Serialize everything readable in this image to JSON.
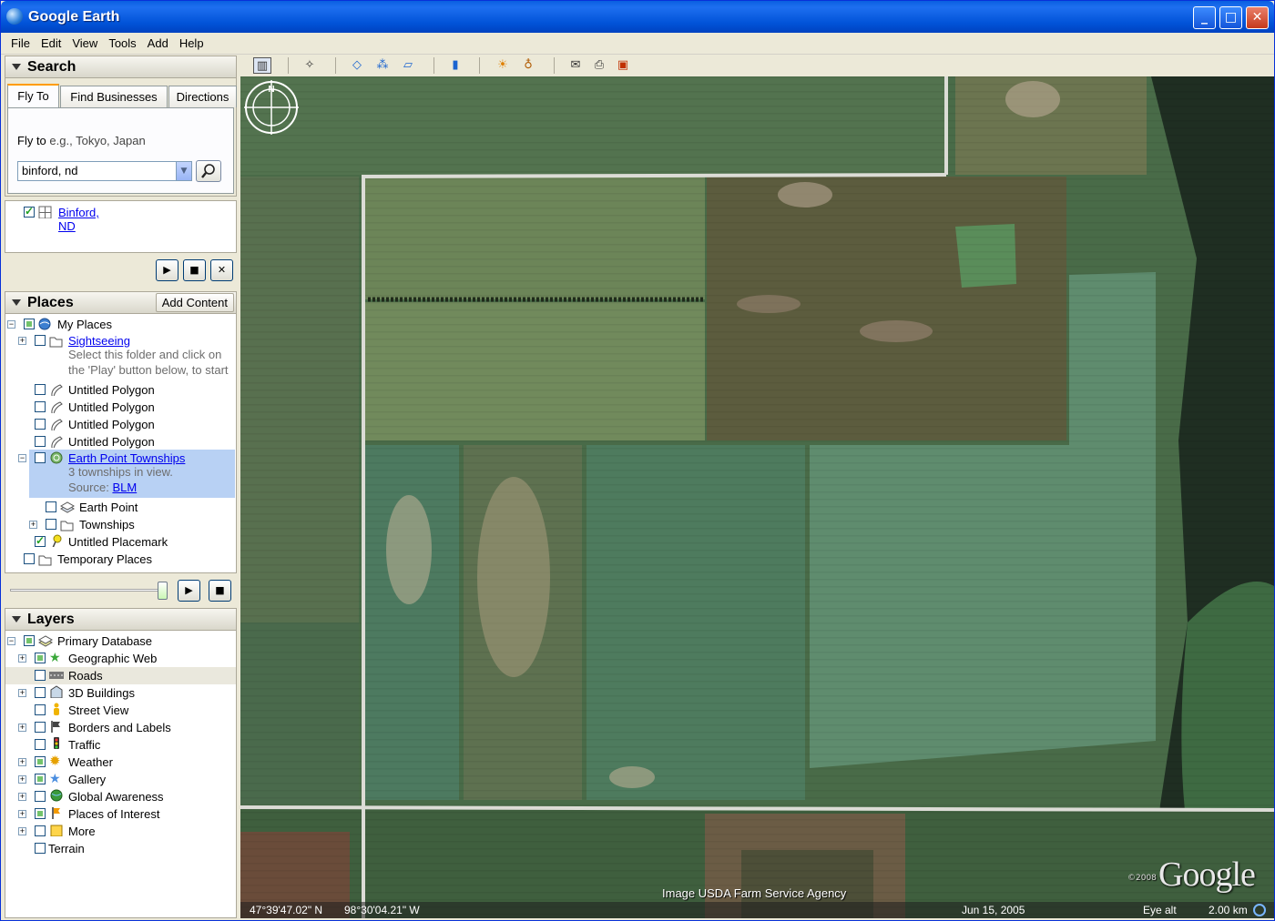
{
  "window": {
    "title": "Google Earth"
  },
  "menu": [
    "File",
    "Edit",
    "View",
    "Tools",
    "Add",
    "Help"
  ],
  "search": {
    "header": "Search",
    "tabs": [
      "Fly To",
      "Find Businesses",
      "Directions"
    ],
    "flyto_label": "Fly to",
    "flyto_placeholder": "e.g., Tokyo, Japan",
    "flyto_value": "binford, nd",
    "result": "Binford, ND"
  },
  "places": {
    "header": "Places",
    "add_content": "Add Content",
    "items": {
      "my_places": "My Places",
      "sightseeing": "Sightseeing",
      "sightseeing_desc1": "Select this folder and click on",
      "sightseeing_desc2": "the 'Play' button below, to start",
      "polygon": "Untitled Polygon",
      "earth_point_townships": "Earth Point Townships",
      "ept_desc": "3 townships in view.",
      "ept_source_label": "Source:",
      "ept_source_link": "BLM",
      "earth_point": "Earth Point",
      "townships": "Townships",
      "placemark": "Untitled Placemark",
      "temporary": "Temporary Places"
    }
  },
  "layers": {
    "header": "Layers",
    "items": [
      "Primary Database",
      "Geographic Web",
      "Roads",
      "3D Buildings",
      "Street View",
      "Borders and Labels",
      "Traffic",
      "Weather",
      "Gallery",
      "Global Awareness",
      "Places of Interest",
      "More",
      "Terrain"
    ]
  },
  "map": {
    "attribution": "Image USDA Farm Service Agency",
    "logo": "Google",
    "logo_year": "©2008",
    "compass_north": "N",
    "status": {
      "lat": "47°39'47.02\" N",
      "lon": "98°30'04.21\" W",
      "date": "Jun 15, 2005",
      "eye_label": "Eye alt",
      "eye_value": "2.00 km"
    }
  },
  "colors": {
    "titlebar": "#0153d8",
    "selection": "#b8d1f4",
    "link": "#0000ee"
  }
}
